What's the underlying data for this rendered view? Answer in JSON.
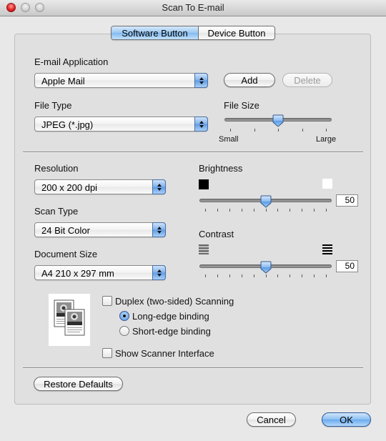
{
  "window": {
    "title": "Scan To E-mail",
    "controls": [
      "close",
      "minimize",
      "zoom"
    ]
  },
  "tabs": [
    {
      "label": "Software Button",
      "selected": true
    },
    {
      "label": "Device Button",
      "selected": false
    }
  ],
  "email_application": {
    "label": "E-mail Application",
    "value": "Apple Mail",
    "add_label": "Add",
    "delete_label": "Delete",
    "delete_enabled": false
  },
  "file_type": {
    "label": "File Type",
    "value": "JPEG (*.jpg)"
  },
  "file_size": {
    "label": "File Size",
    "min_label": "Small",
    "max_label": "Large",
    "ticks": 5,
    "position": 0.5
  },
  "resolution": {
    "label": "Resolution",
    "value": "200 x 200 dpi"
  },
  "scan_type": {
    "label": "Scan Type",
    "value": "24 Bit Color"
  },
  "document_size": {
    "label": "Document Size",
    "value": "A4  210 x 297 mm"
  },
  "brightness": {
    "label": "Brightness",
    "value": "50",
    "min": 0,
    "max": 100,
    "ticks": 11,
    "low_icon": "dark-square-icon",
    "high_icon": "light-square-icon"
  },
  "contrast": {
    "label": "Contrast",
    "value": "50",
    "min": 0,
    "max": 100,
    "ticks": 11,
    "low_icon": "low-contrast-stripes-icon",
    "high_icon": "high-contrast-stripes-icon"
  },
  "duplex": {
    "icon": "duplex-pages-icon",
    "label": "Duplex (two-sided) Scanning",
    "checked": false,
    "options": [
      {
        "label": "Long-edge binding",
        "selected": true
      },
      {
        "label": "Short-edge binding",
        "selected": false
      }
    ]
  },
  "show_scanner_interface": {
    "label": "Show Scanner Interface",
    "checked": false
  },
  "buttons": {
    "restore_defaults": "Restore Defaults",
    "cancel": "Cancel",
    "ok": "OK"
  }
}
